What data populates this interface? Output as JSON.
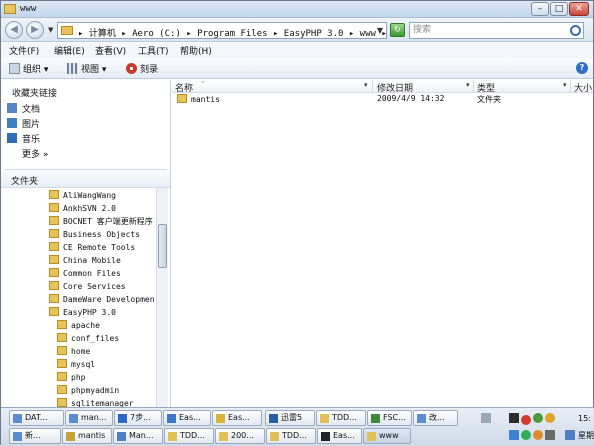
{
  "window": {
    "title": "www"
  },
  "address": {
    "crumbs": "▸ 计算机 ▸ Aero (C:) ▸ Program Files ▸ EasyPHP 3.0 ▸ www ▸",
    "search_placeholder": "搜索"
  },
  "menu": [
    "文件(F)",
    "编辑(E)",
    "查看(V)",
    "工具(T)",
    "帮助(H)"
  ],
  "toolbar": {
    "organize": "组织 ▾",
    "views": "视图 ▾",
    "burn": "刻录"
  },
  "favorites": {
    "title": "收藏夹链接",
    "items": [
      "文档",
      "图片",
      "音乐",
      "更多  »"
    ]
  },
  "folders": {
    "title": "文件夹",
    "items": [
      "AliWangWang",
      "AnkhSVN 2.0",
      "BOCNET 客户端更新程序",
      "Business Objects",
      "CE Remote Tools",
      "China Mobile",
      "Common Files",
      "Core Services",
      "DameWare Development",
      "EasyPHP 3.0",
      "apache",
      "conf_files",
      "home",
      "mysql",
      "php",
      "phpmyadmin",
      "sqlitemanager"
    ]
  },
  "columns": [
    "名称",
    "修改日期",
    "类型",
    "大小"
  ],
  "files": [
    {
      "name": "mantis",
      "date": "2009/4/9 14:32",
      "type": "文件夹"
    }
  ],
  "taskbar": {
    "row1": [
      "DAT...",
      "man...",
      "7步...",
      "Eas...",
      "Eas...",
      "迅雷5",
      "TDD...",
      "FSC...",
      "改..."
    ],
    "row2": [
      "新...",
      "mantis",
      "Man...",
      "TDD...",
      "200...",
      "TDD...",
      "Eas...",
      "www"
    ],
    "clock_top": "15:",
    "clock_bottom": "星期"
  }
}
